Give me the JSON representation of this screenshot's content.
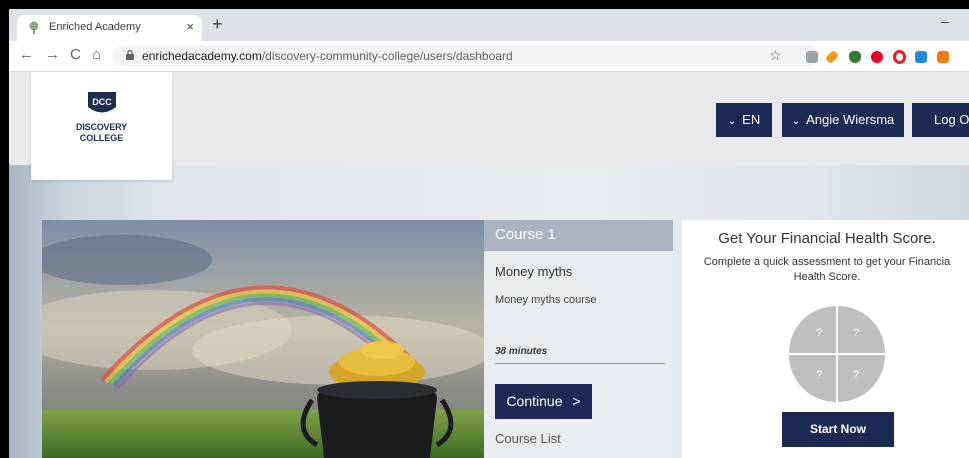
{
  "browser": {
    "tab_title": "Enriched Academy",
    "tab_close": "×",
    "new_tab": "+",
    "minimize": "–",
    "url_host": "enrichedacademy.com",
    "url_path": "/discovery-community-college/users/dashboard",
    "nav": {
      "back": "←",
      "forward": "→",
      "reload": "C",
      "home": "⌂"
    },
    "star": "☆",
    "extensions": [
      "puzzle-icon",
      "key-icon",
      "shield-icon",
      "pinterest-icon",
      "opera-icon",
      "calendar-icon",
      "briefcase-icon"
    ]
  },
  "header": {
    "logo_mark": "DCC",
    "logo_line1": "DISCOVERY",
    "logo_line2": "COLLEGE",
    "language_label": "EN",
    "user_label": "Angie Wiersma",
    "logout_label": "Log O"
  },
  "course": {
    "number": "Course 1",
    "title": "Money myths",
    "subtitle": "Money myths course",
    "duration": "38 minutes",
    "progress": 0,
    "continue_label": "Continue",
    "continue_chevron": ">",
    "list_label": "Course List"
  },
  "financial": {
    "title": "Get Your Financial Health Score.",
    "desc_line1": "Complete a quick assessment to get your Financia",
    "desc_line2": "Health Score.",
    "quadrants": [
      "?",
      "?",
      "?",
      "?"
    ],
    "start_label": "Start Now"
  },
  "colors": {
    "navy": "#1a2a52",
    "course_bar": "#aab3bf",
    "quadrant_gray": "#bfbfbf"
  }
}
